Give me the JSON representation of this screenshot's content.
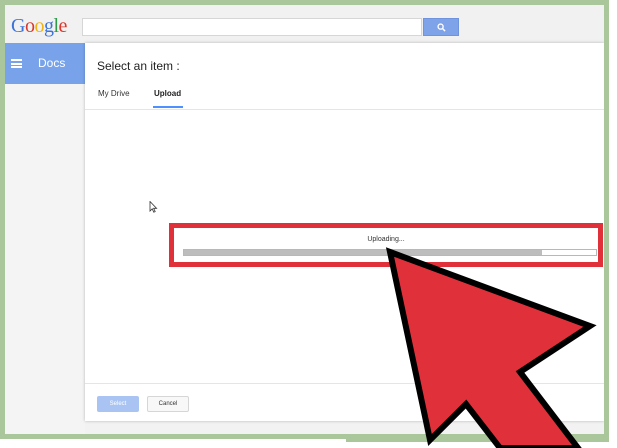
{
  "header": {
    "logo_letters": [
      {
        "ch": "G",
        "color": "#3b73d8"
      },
      {
        "ch": "o",
        "color": "#d9392c"
      },
      {
        "ch": "o",
        "color": "#f1b214"
      },
      {
        "ch": "g",
        "color": "#3b73d8"
      },
      {
        "ch": "l",
        "color": "#2d9a4a"
      },
      {
        "ch": "e",
        "color": "#d9392c"
      }
    ],
    "search_value": "",
    "search_icon": "search-icon"
  },
  "sidebar": {
    "menu_icon": "hamburger-menu-icon",
    "title": "Docs"
  },
  "dialog": {
    "title": "Select an item :",
    "tabs": [
      {
        "label": "My Drive",
        "active": false
      },
      {
        "label": "Upload",
        "active": true
      }
    ],
    "upload": {
      "status": "Uploading...",
      "progress": 0.87
    },
    "buttons": {
      "select": "Select",
      "cancel": "Cancel"
    }
  },
  "colors": {
    "frame": "#a9c79a",
    "accent_blue": "#78a3ea",
    "highlight_red": "#e0313a",
    "arrow_red": "#e0313a"
  }
}
